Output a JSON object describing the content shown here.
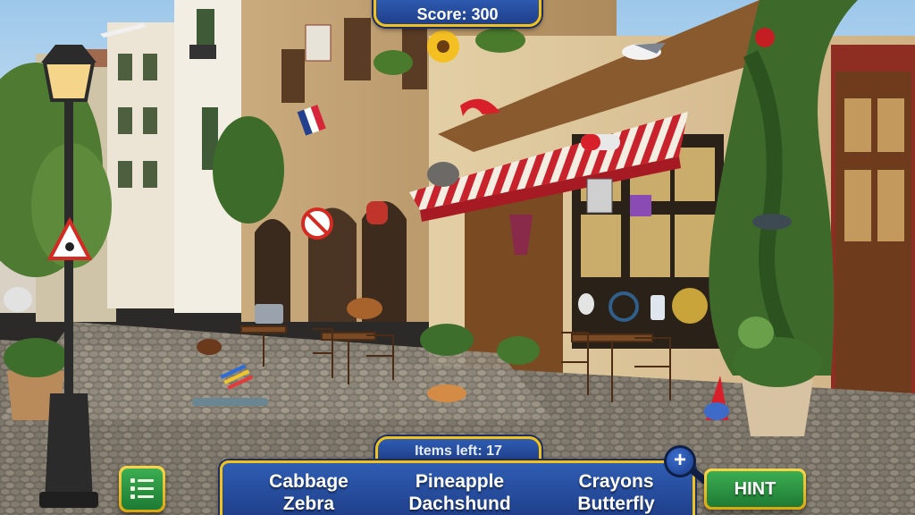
{
  "hud": {
    "score_text": "Score: 300",
    "items_left_text": "Items left: 17",
    "hint_label": "HINT",
    "zoom_glyph": "+"
  },
  "items": [
    [
      "Cabbage",
      "Zebra"
    ],
    [
      "Pineapple",
      "Dachshund"
    ],
    [
      "Crayons",
      "Butterfly"
    ]
  ],
  "scene_signs": {
    "triangle_sign": "roadworks-warning-sign",
    "round_sign": "no-dogs-sign",
    "flag": "french-flag"
  },
  "colors": {
    "panel_blue": "#2a52a8",
    "panel_gold": "#f2c21a",
    "hint_green": "#2e9a45",
    "awning_red": "#c8232c"
  },
  "icons": {
    "menu": "list-icon",
    "zoom": "magnifier-plus-icon"
  }
}
